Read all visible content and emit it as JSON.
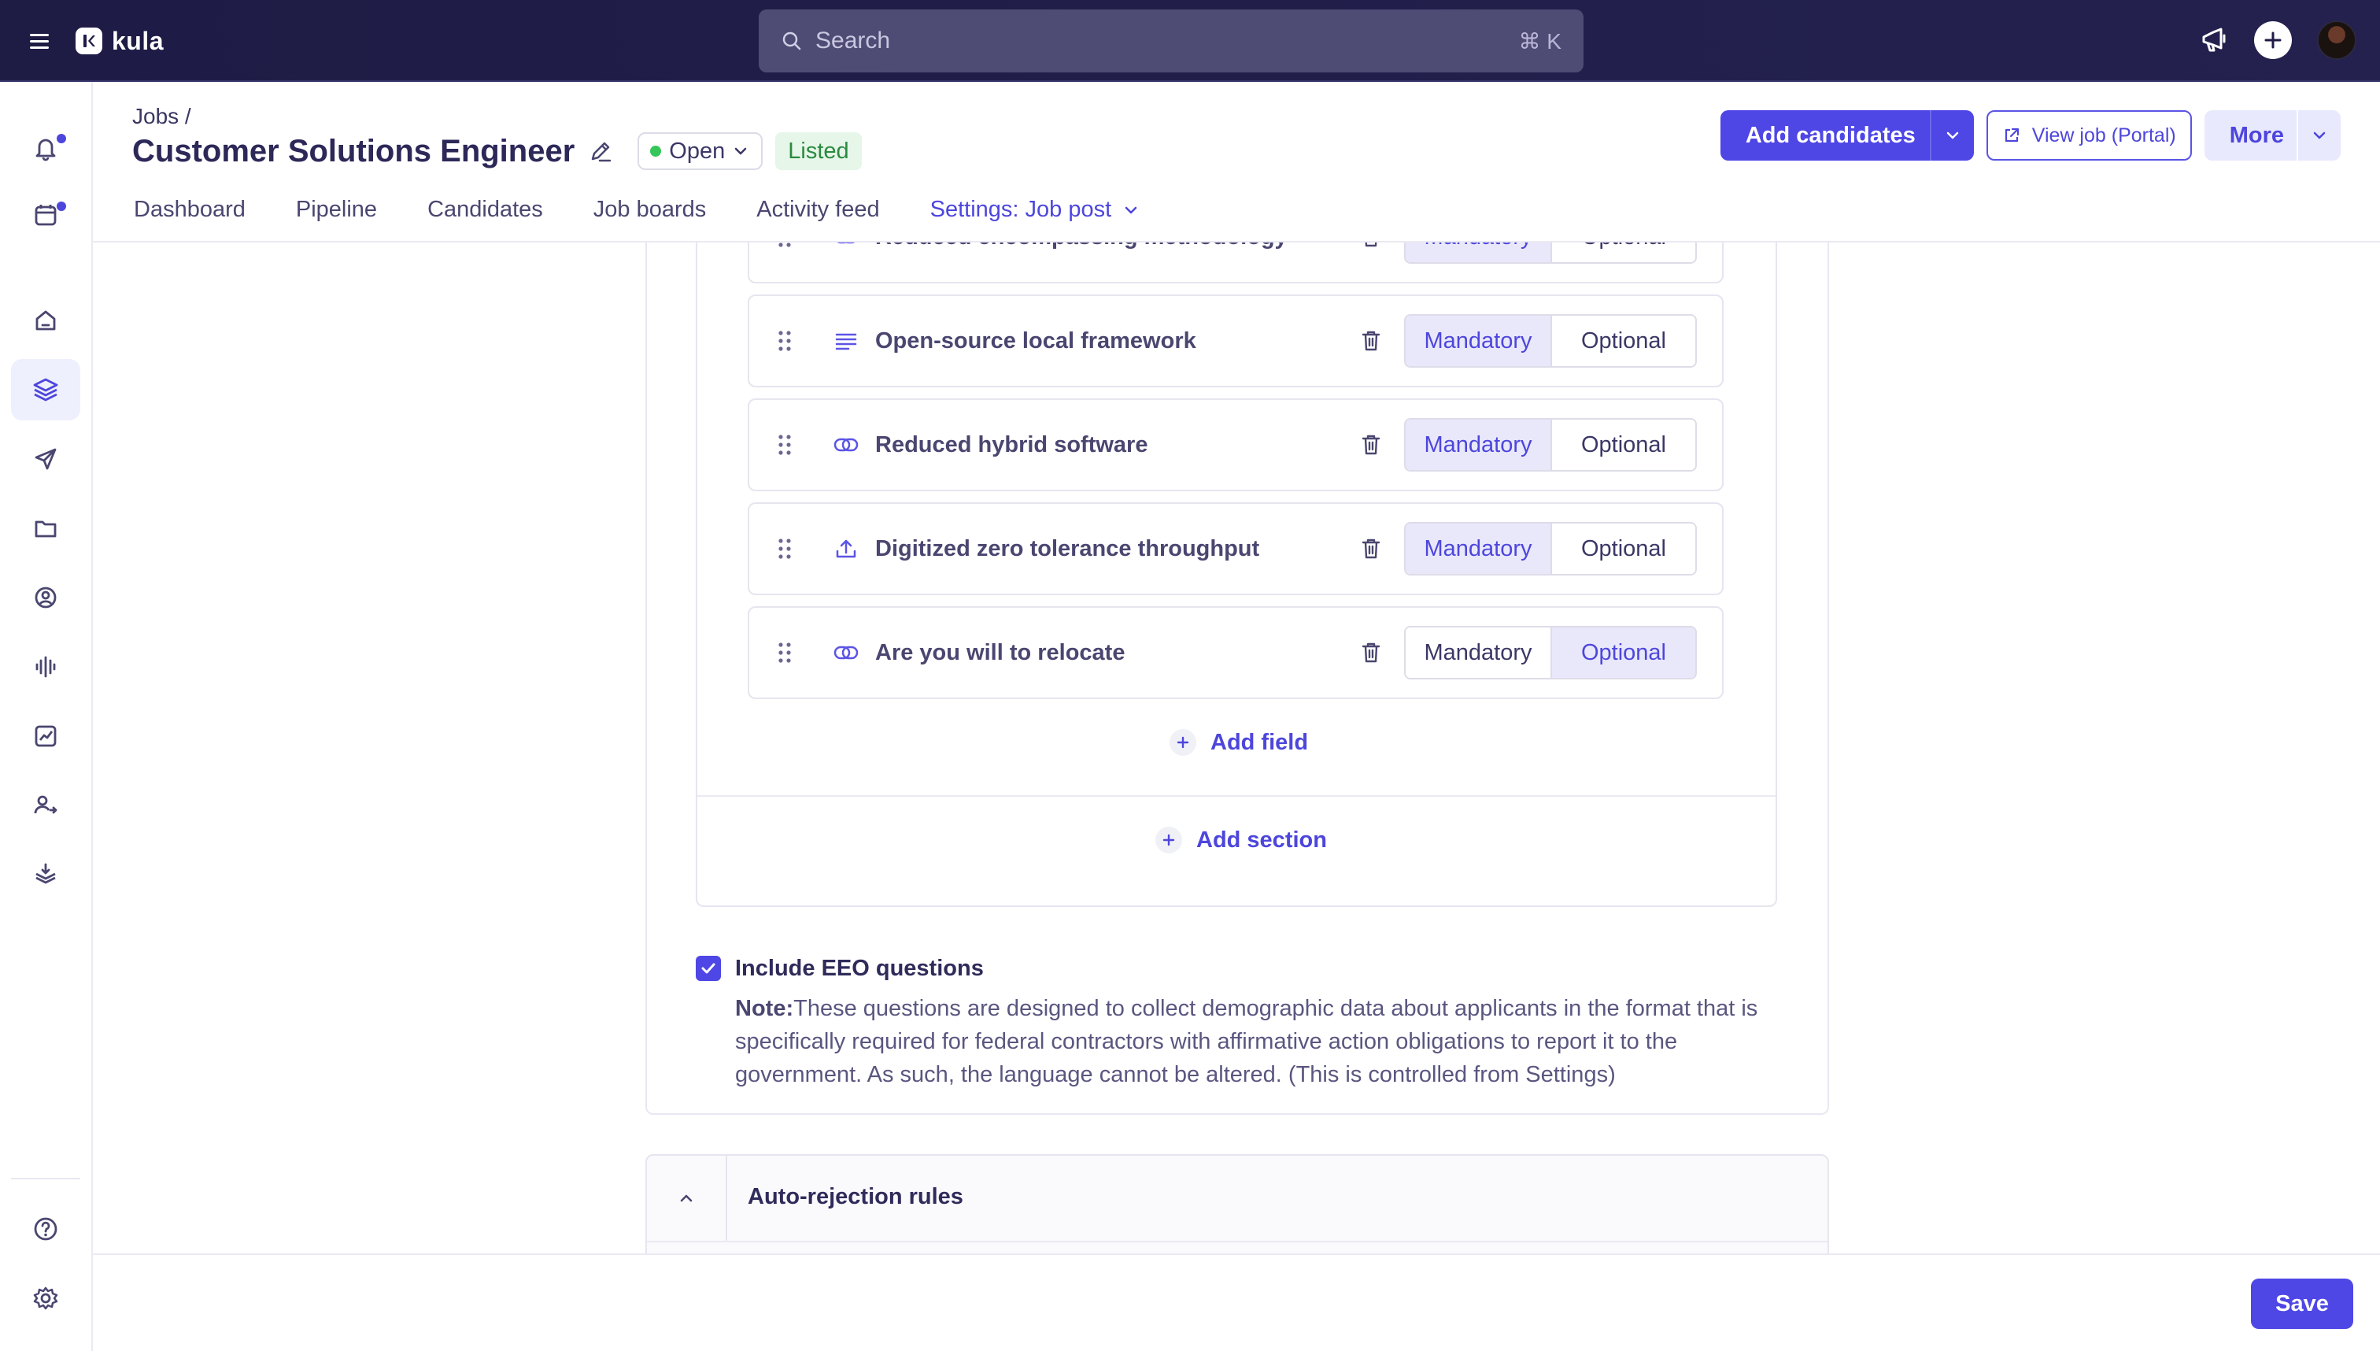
{
  "app": {
    "name": "kula"
  },
  "search": {
    "placeholder": "Search",
    "shortcut": "⌘ K"
  },
  "header": {
    "breadcrumb": "Jobs /",
    "title": "Customer Solutions Engineer",
    "status": "Open",
    "badge": "Listed",
    "tabs": [
      {
        "label": "Dashboard"
      },
      {
        "label": "Pipeline"
      },
      {
        "label": "Candidates"
      },
      {
        "label": "Job boards"
      },
      {
        "label": "Activity feed"
      },
      {
        "label": "Settings: Job post"
      }
    ],
    "actions": {
      "add_candidates": "Add candidates",
      "view_job": "View job (Portal)",
      "more": "More"
    }
  },
  "form": {
    "fields": [
      {
        "label": "Reduced encompassing methodology",
        "icon": "link-icon",
        "required": "Mandatory"
      },
      {
        "label": "Open-source local framework",
        "icon": "text-lines-icon",
        "required": "Mandatory"
      },
      {
        "label": "Reduced hybrid software",
        "icon": "link-icon",
        "required": "Mandatory"
      },
      {
        "label": "Digitized zero tolerance throughput",
        "icon": "upload-icon",
        "required": "Mandatory"
      },
      {
        "label": "Are you will to relocate",
        "icon": "link-icon",
        "required": "Optional"
      }
    ],
    "option_mandatory": "Mandatory",
    "option_optional": "Optional",
    "add_field": "Add field",
    "add_section": "Add section"
  },
  "eeo": {
    "checked": true,
    "label": "Include EEO questions",
    "note_prefix": "Note:",
    "note": "These questions are designed to collect demographic data about applicants in the format that is specifically required for federal contractors with affirmative action obligations to report it to the government. As such, the language cannot be altered. (This is controlled from Settings)"
  },
  "rules": {
    "title": "Auto-rejection rules"
  },
  "footer": {
    "save": "Save"
  },
  "colors": {
    "accent": "#4e46e5",
    "topbar": "#1e1b45",
    "listed_bg": "#e6f6e9",
    "status_dot": "#35c759"
  }
}
